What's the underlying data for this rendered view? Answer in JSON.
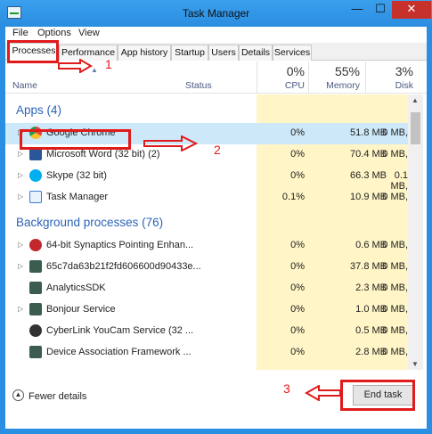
{
  "window": {
    "title": "Task Manager",
    "minimize_glyph": "—",
    "maximize_glyph": "☐",
    "close_glyph": "✕"
  },
  "menu": [
    "File",
    "Options",
    "View"
  ],
  "tabs": [
    "Processes",
    "Performance",
    "App history",
    "Startup",
    "Users",
    "Details",
    "Services"
  ],
  "columns": {
    "name": "Name",
    "status": "Status",
    "cpu": {
      "percent": "0%",
      "label": "CPU"
    },
    "memory": {
      "percent": "55%",
      "label": "Memory"
    },
    "disk": {
      "percent": "3%",
      "label": "Disk"
    }
  },
  "groups": {
    "apps": "Apps (4)",
    "background": "Background processes (76)"
  },
  "apps": [
    {
      "name": "Google Chrome",
      "cpu": "0%",
      "memory": "51.8 MB",
      "disk": "0 MB,",
      "icon": "chrome-icon",
      "color": "#dd4b39"
    },
    {
      "name": "Microsoft Word (32 bit) (2)",
      "cpu": "0%",
      "memory": "70.4 MB",
      "disk": "0 MB,",
      "icon": "word-icon",
      "color": "#2b579a"
    },
    {
      "name": "Skype (32 bit)",
      "cpu": "0%",
      "memory": "66.3 MB",
      "disk": "0.1 MB,",
      "icon": "skype-icon",
      "color": "#00aff0"
    },
    {
      "name": "Task Manager",
      "cpu": "0.1%",
      "memory": "10.9 MB",
      "disk": "0 MB,",
      "icon": "task-manager-icon",
      "color": "#3a7bd5"
    }
  ],
  "background": [
    {
      "name": "64-bit Synaptics Pointing Enhan...",
      "cpu": "0%",
      "memory": "0.6 MB",
      "disk": "0 MB,",
      "icon": "synaptics-icon",
      "color": "#c0282d"
    },
    {
      "name": "65c7da63b21f2fd606600d90433e...",
      "cpu": "0%",
      "memory": "37.8 MB",
      "disk": "0 MB,",
      "icon": "process-icon",
      "color": "#3b5d50"
    },
    {
      "name": "AnalyticsSDK",
      "cpu": "0%",
      "memory": "2.3 MB",
      "disk": "0 MB,",
      "icon": "process-icon",
      "color": "#3b5d50"
    },
    {
      "name": "Bonjour Service",
      "cpu": "0%",
      "memory": "1.0 MB",
      "disk": "0 MB,",
      "icon": "process-icon",
      "color": "#3b5d50"
    },
    {
      "name": "CyberLink YouCam Service (32 ...",
      "cpu": "0%",
      "memory": "0.5 MB",
      "disk": "0 MB,",
      "icon": "youcam-icon",
      "color": "#333333"
    },
    {
      "name": "Device Association Framework ...",
      "cpu": "0%",
      "memory": "2.8 MB",
      "disk": "0 MB,",
      "icon": "process-icon",
      "color": "#3b5d50"
    }
  ],
  "footer": {
    "fewer_details": "Fewer details",
    "end_task": "End task"
  },
  "annotations": [
    "1",
    "2",
    "3"
  ],
  "colors": {
    "accent": "#2b8de0",
    "annotation": "#e01b1b",
    "group_header": "#2c63b8",
    "selected_row": "#cde8f8",
    "heat": "#fff5c6"
  }
}
